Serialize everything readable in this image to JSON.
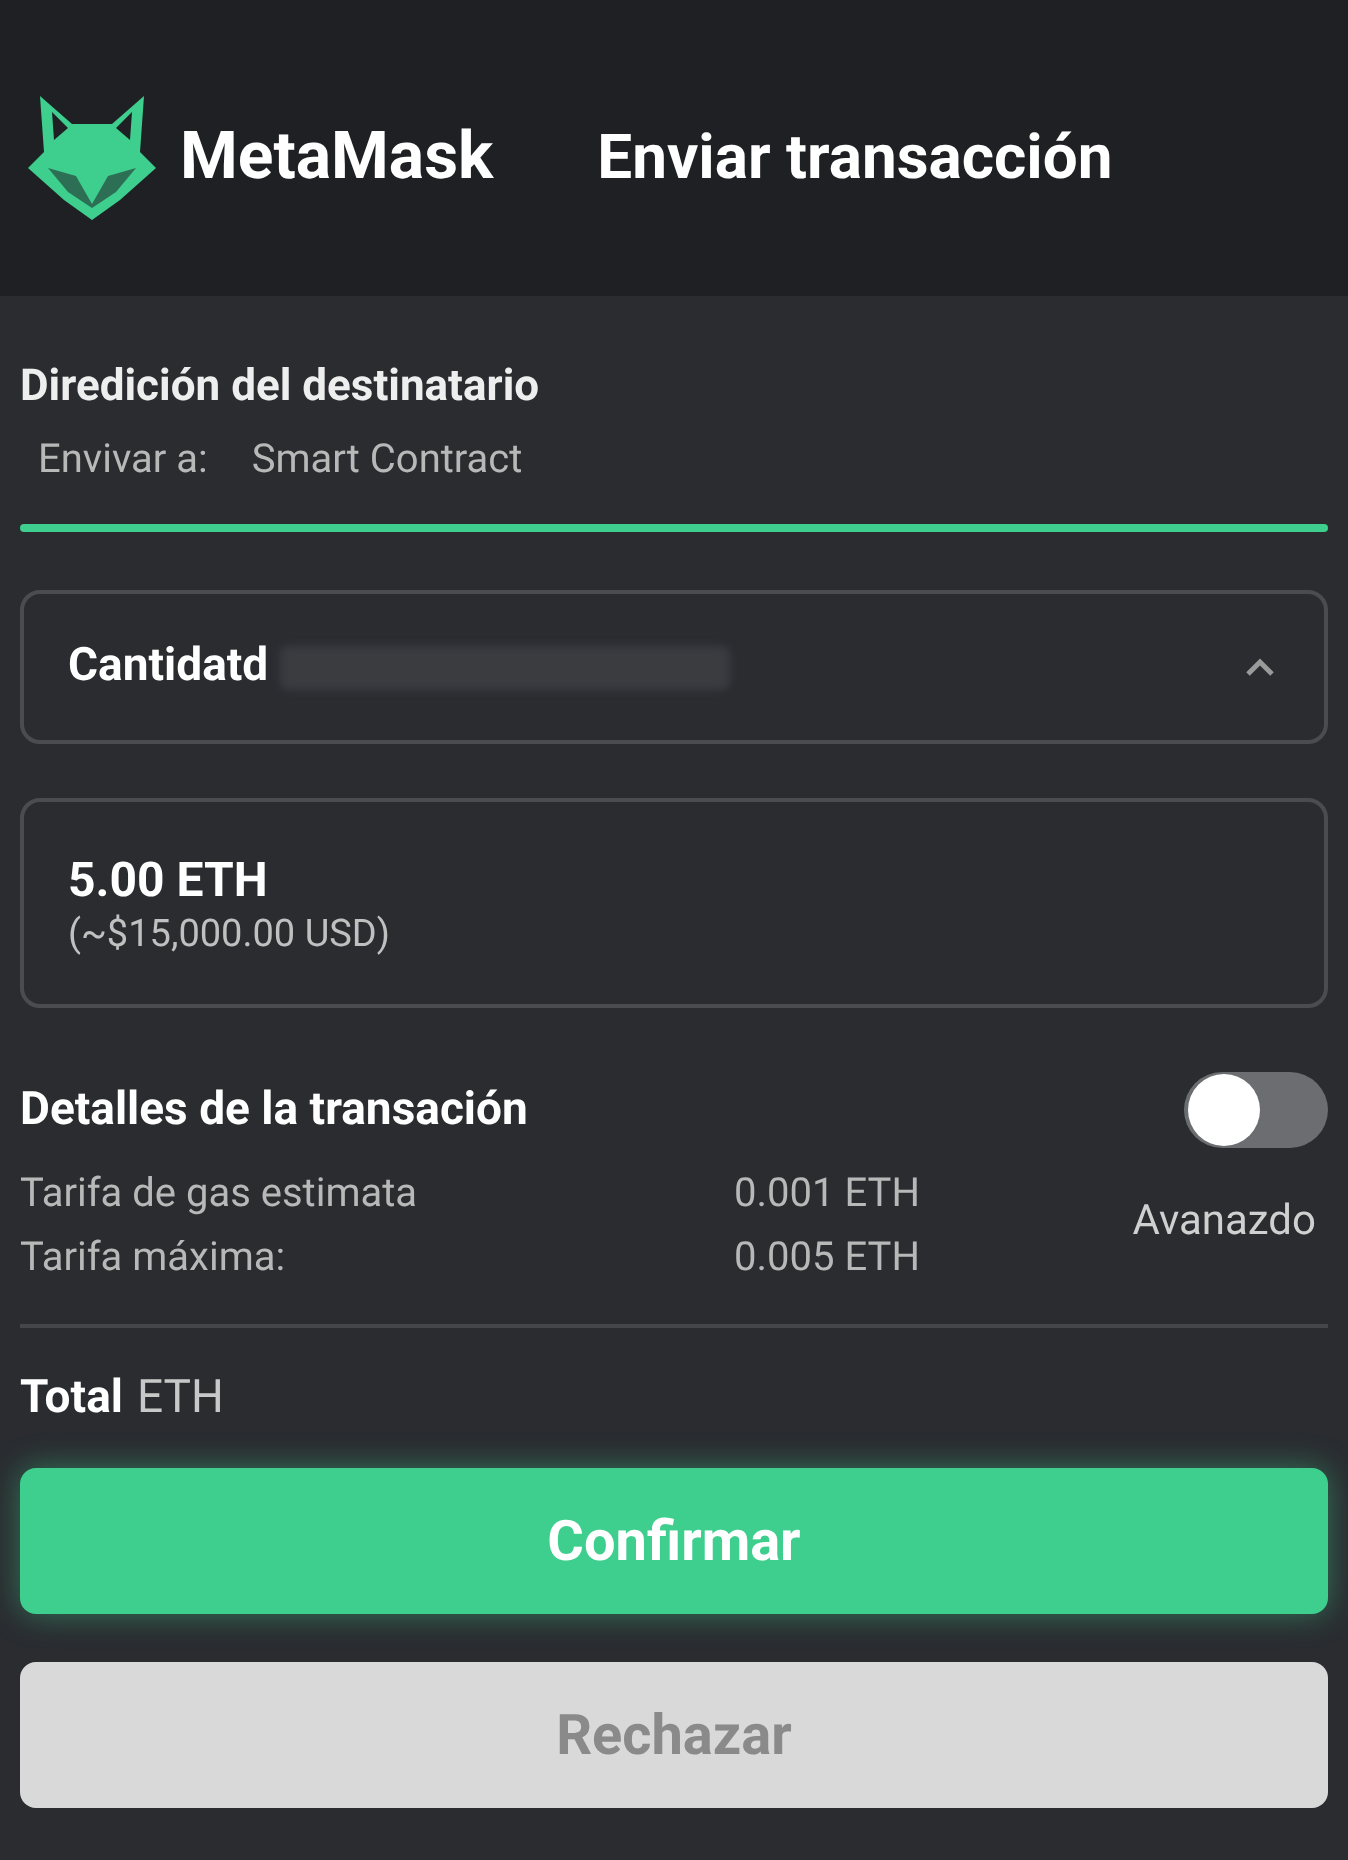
{
  "header": {
    "brand": "MetaMask",
    "title": "Enviar transacción"
  },
  "recipient": {
    "heading": "Diredición del destinatario",
    "label": "Envivar a:",
    "value": "Smart Contract"
  },
  "amount_select": {
    "label": "Cantidatd",
    "address_redacted": true,
    "expanded": true
  },
  "amount": {
    "value": "5.00 ETH",
    "fiat": "(~$15,000.00 USD)"
  },
  "details": {
    "heading": "Detalles de la transación",
    "advanced_on": false,
    "advanced_label": "Avanazdo",
    "rows": [
      {
        "label": "Tarifa de gas estimata",
        "value": "0.001 ETH"
      },
      {
        "label": "Tarifa máxima:",
        "value": "0.005 ETH"
      }
    ]
  },
  "total": {
    "label": "Total",
    "value": "ETH"
  },
  "buttons": [
    {
      "label": "Confirmar",
      "kind": "primary"
    },
    {
      "label": "Rechazar",
      "kind": "secondary"
    }
  ]
}
